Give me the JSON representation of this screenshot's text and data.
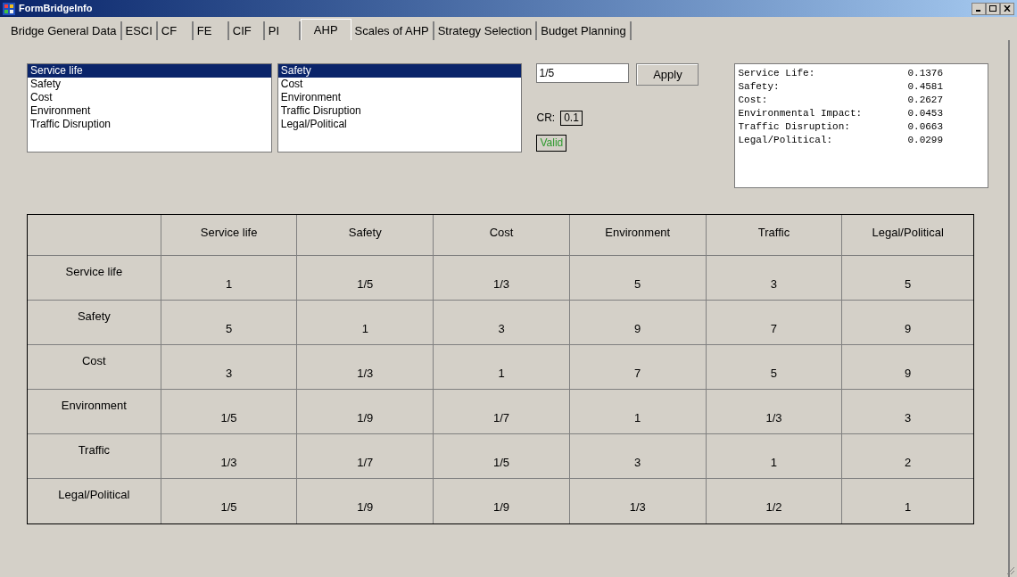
{
  "window": {
    "title": "FormBridgeInfo"
  },
  "tabs": [
    {
      "label": "Bridge General Data",
      "selected": false
    },
    {
      "label": "ESCI",
      "selected": false
    },
    {
      "label": "CF",
      "selected": false
    },
    {
      "label": "FE",
      "selected": false
    },
    {
      "label": "CIF",
      "selected": false
    },
    {
      "label": "PI",
      "selected": false
    },
    {
      "label": "AHP",
      "selected": true
    },
    {
      "label": "Scales of AHP",
      "selected": false
    },
    {
      "label": "Strategy Selection",
      "selected": false
    },
    {
      "label": "Budget Planning",
      "selected": false
    }
  ],
  "list_1": [
    {
      "label": "Service life",
      "selected": true
    },
    {
      "label": "Safety",
      "selected": false
    },
    {
      "label": "Cost",
      "selected": false
    },
    {
      "label": "Environment",
      "selected": false
    },
    {
      "label": "Traffic Disruption",
      "selected": false
    }
  ],
  "list_2": [
    {
      "label": "Safety",
      "selected": true
    },
    {
      "label": "Cost",
      "selected": false
    },
    {
      "label": "Environment",
      "selected": false
    },
    {
      "label": "Traffic Disruption",
      "selected": false
    },
    {
      "label": "Legal/Political",
      "selected": false
    }
  ],
  "value_field": {
    "value": "1/5"
  },
  "apply_button": "Apply",
  "cr": {
    "label": "CR:",
    "value": "0.1"
  },
  "status": "Valid",
  "weights": [
    {
      "name": "Service Life:",
      "value": "0.1376"
    },
    {
      "name": "Safety:",
      "value": "0.4581"
    },
    {
      "name": "Cost:",
      "value": "0.2627"
    },
    {
      "name": "Environmental Impact:",
      "value": "0.0453"
    },
    {
      "name": "Traffic Disruption:",
      "value": "0.0663"
    },
    {
      "name": "Legal/Political:",
      "value": "0.0299"
    }
  ],
  "table": {
    "columns": [
      "Service life",
      "Safety",
      "Cost",
      "Environment",
      "Traffic",
      "Legal/Political"
    ],
    "rows": [
      {
        "label": "Service life",
        "cells": [
          "1",
          "1/5",
          "1/3",
          "5",
          "3",
          "5"
        ]
      },
      {
        "label": "Safety",
        "cells": [
          "5",
          "1",
          "3",
          "9",
          "7",
          "9"
        ]
      },
      {
        "label": "Cost",
        "cells": [
          "3",
          "1/3",
          "1",
          "7",
          "5",
          "9"
        ]
      },
      {
        "label": "Environment",
        "cells": [
          "1/5",
          "1/9",
          "1/7",
          "1",
          "1/3",
          "3"
        ]
      },
      {
        "label": "Traffic",
        "cells": [
          "1/3",
          "1/7",
          "1/5",
          "3",
          "1",
          "2"
        ]
      },
      {
        "label": "Legal/Political",
        "cells": [
          "1/5",
          "1/9",
          "1/9",
          "1/3",
          "1/2",
          "1"
        ]
      }
    ]
  }
}
